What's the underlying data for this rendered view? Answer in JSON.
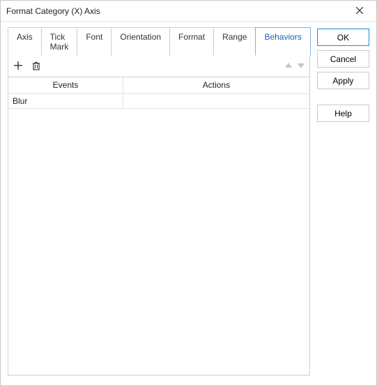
{
  "window": {
    "title": "Format Category (X) Axis"
  },
  "tabs": {
    "axis": "Axis",
    "tickmark": "Tick Mark",
    "font": "Font",
    "orientation": "Orientation",
    "format": "Format",
    "range": "Range",
    "behaviors": "Behaviors"
  },
  "toolbar": {
    "add_name": "add",
    "delete_name": "delete",
    "up_name": "move-up",
    "down_name": "move-down"
  },
  "grid": {
    "headers": {
      "events": "Events",
      "actions": "Actions"
    },
    "rows": [
      {
        "event": "Blur",
        "action": ""
      }
    ]
  },
  "buttons": {
    "ok": "OK",
    "cancel": "Cancel",
    "apply": "Apply",
    "help": "Help"
  }
}
